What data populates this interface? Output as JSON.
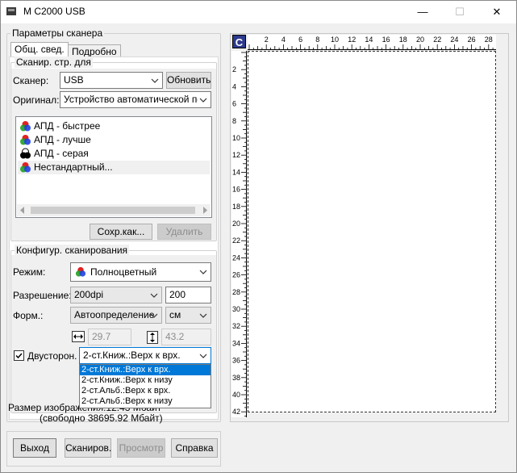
{
  "window": {
    "title": "M C2000 USB",
    "minimize_glyph": "—",
    "maximize_glyph": "☐",
    "close_glyph": "✕"
  },
  "scanner_params": {
    "group_label": "Параметры сканера",
    "tabs": [
      {
        "label": "Общ. свед.",
        "active": true
      },
      {
        "label": "Подробно",
        "active": false
      }
    ]
  },
  "scan_profile": {
    "group_label": "Сканир. стр. для",
    "scanner_label": "Сканер:",
    "scanner_value": "USB",
    "refresh_button": "Обновить",
    "original_label": "Оригинал:",
    "original_value": "Устройство автоматической под",
    "profiles": [
      {
        "label": "АПД - быстрее",
        "icon": "color-rgb-icon"
      },
      {
        "label": "АПД - лучше",
        "icon": "color-rgb-icon"
      },
      {
        "label": "АПД - серая",
        "icon": "grayscale-icon"
      },
      {
        "label": "Нестандартный...",
        "icon": "color-rgb-icon",
        "selected": true
      }
    ],
    "save_as_button": "Сохр.как...",
    "delete_button": "Удалить"
  },
  "scan_config": {
    "group_label": "Конфигур. сканирования",
    "mode_label": "Режим:",
    "mode_value": "Полноцветный",
    "resolution_label": "Разрешение:",
    "resolution_value": "200dpi",
    "resolution_number": "200",
    "format_label": "Форм.:",
    "format_value": "Автоопределение",
    "unit_value": "см",
    "width_value": "29.7",
    "height_value": "43.2",
    "duplex_label": "Двусторон.",
    "duplex_checked": true,
    "duplex_value": "2-ст.Книж.:Верх к врх.",
    "duplex_options": [
      "2-ст.Книж.:Верх к врх.",
      "2-ст.Книж.:Верх к низу",
      "2-ст.Альб.:Верх к врх.",
      "2-ст.Альб.:Верх к низу"
    ]
  },
  "image_size": {
    "line1": "Размер изображения:12.43 Мбайт",
    "line2": "(свободно 38695.92 Мбайт)"
  },
  "footer": {
    "exit_button": "Выход",
    "scan_button": "Сканиров.",
    "preview_button": "Просмотр",
    "help_button": "Справка"
  },
  "preview": {
    "corner_label": "C",
    "ruler_top_labels": [
      "2",
      "4",
      "6",
      "8",
      "10",
      "12",
      "14",
      "16",
      "18",
      "20",
      "22",
      "24",
      "26",
      "28"
    ],
    "ruler_left_labels": [
      "2",
      "4",
      "6",
      "8",
      "10",
      "12",
      "14",
      "16",
      "18",
      "20",
      "22",
      "24",
      "26",
      "28",
      "30",
      "32",
      "34",
      "36",
      "38",
      "40",
      "42"
    ]
  },
  "colors": {
    "selection_blue": "#0078d7",
    "window_bg": "#f0f0f0"
  }
}
